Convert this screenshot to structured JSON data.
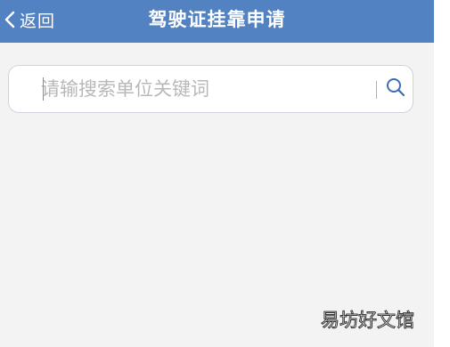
{
  "nav": {
    "back_label": "返回",
    "title": "驾驶证挂靠申请",
    "background_color": "#5282c2"
  },
  "search": {
    "placeholder": "请输搜索单位关键词",
    "value": "",
    "icon": "search-icon"
  },
  "icons": {
    "back": "chevron-left-icon",
    "search": "search-icon"
  },
  "watermark": {
    "text": "易坊好文馆"
  },
  "colors": {
    "page_background": "#f3f3f3",
    "accent": "#3a6fb5"
  }
}
